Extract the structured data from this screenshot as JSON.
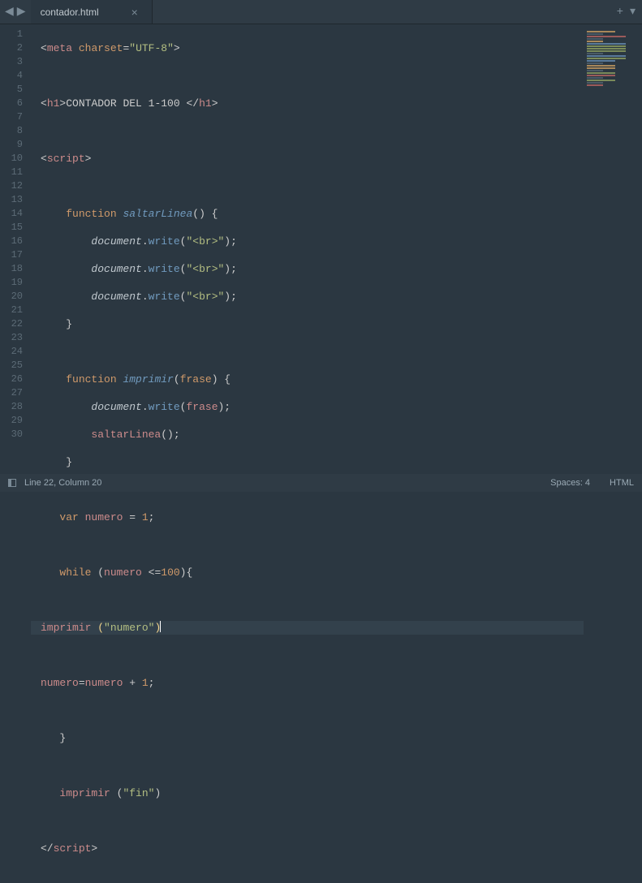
{
  "tab": {
    "title": "contador.html"
  },
  "status": {
    "lineCol": "Line 22, Column 20",
    "spaces": "Spaces: 4",
    "lang": "HTML"
  },
  "gutter": [
    "1",
    "2",
    "3",
    "4",
    "5",
    "6",
    "7",
    "8",
    "9",
    "10",
    "11",
    "12",
    "13",
    "14",
    "15",
    "16",
    "17",
    "18",
    "19",
    "20",
    "21",
    "22",
    "23",
    "24",
    "25",
    "26",
    "27",
    "28",
    "29",
    "30"
  ],
  "code": {
    "l1_tag": "meta",
    "l1_attr": "charset",
    "l1_val": "\"UTF-8\"",
    "l3_tag": "h1",
    "l3_text": "CONTADOR DEL 1-100 ",
    "l3_close": "h1",
    "l5_tag": "script",
    "l7_kw": "function",
    "l7_name": "saltarLinea",
    "l7_b": "() {",
    "l8_obj": "document",
    "l8_fn": "write",
    "l8_s": "\"<br>\"",
    "l9_obj": "document",
    "l9_fn": "write",
    "l9_s": "\"<br>\"",
    "l10_obj": "document",
    "l10_fn": "write",
    "l10_s": "\"<br>\"",
    "l13_kw": "function",
    "l13_name": "imprimir",
    "l13_arg": "frase",
    "l13_b": ") {",
    "l14_obj": "document",
    "l14_fn": "write",
    "l14_arg": "frase",
    "l15_fn": "saltarLinea",
    "l18_kw": "var",
    "l18_name": "numero",
    "l18_eq": " = ",
    "l18_num": "1",
    "l20_kw": "while",
    "l20_var": "numero",
    "l20_op": " <=",
    "l20_num": "100",
    "l22_fn": "imprimir",
    "l22_s": "\"numero\"",
    "l24_v1": "numero",
    "l24_eq": "=",
    "l24_v2": "numero",
    "l24_op": " + ",
    "l24_num": "1",
    "l28_fn": "imprimir",
    "l28_s": "\"fin\"",
    "l30_tag": "script"
  }
}
